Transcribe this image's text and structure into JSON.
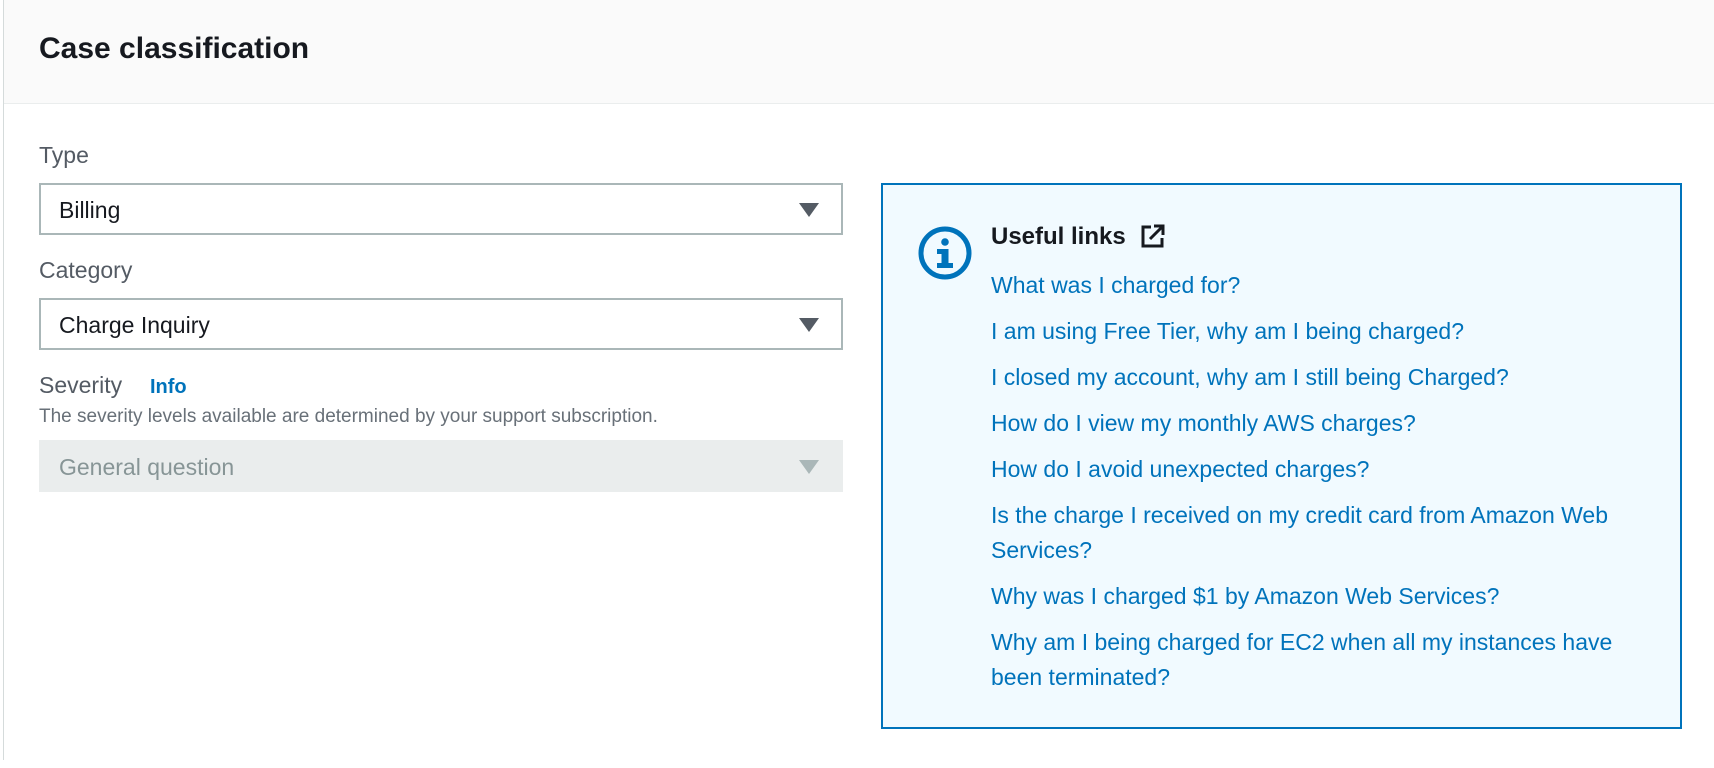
{
  "section": {
    "title": "Case classification"
  },
  "type_field": {
    "label": "Type",
    "value": "Billing"
  },
  "category_field": {
    "label": "Category",
    "value": "Charge Inquiry"
  },
  "severity_field": {
    "label": "Severity",
    "info_link": "Info",
    "description": "The severity levels available are determined by your support subscription.",
    "value": "General question",
    "disabled": true
  },
  "useful_links": {
    "title": "Useful links",
    "icons": {
      "info": "info-circle-icon",
      "external": "external-link-icon"
    },
    "links": [
      "What was I charged for?",
      "I am using Free Tier, why am I being charged?",
      "I closed my account, why am I still being Charged?",
      "How do I view my monthly AWS charges?",
      "How do I avoid unexpected charges?",
      "Is the charge I received on my credit card from Amazon Web Services?",
      "Why was I charged $1 by Amazon Web Services?",
      "Why am I being charged for EC2 when all my instances have been terminated?"
    ]
  },
  "colors": {
    "link": "#0073bb",
    "info_box_bg": "#f1faff",
    "info_box_border": "#0073bb",
    "header_bg": "#fafafa"
  }
}
